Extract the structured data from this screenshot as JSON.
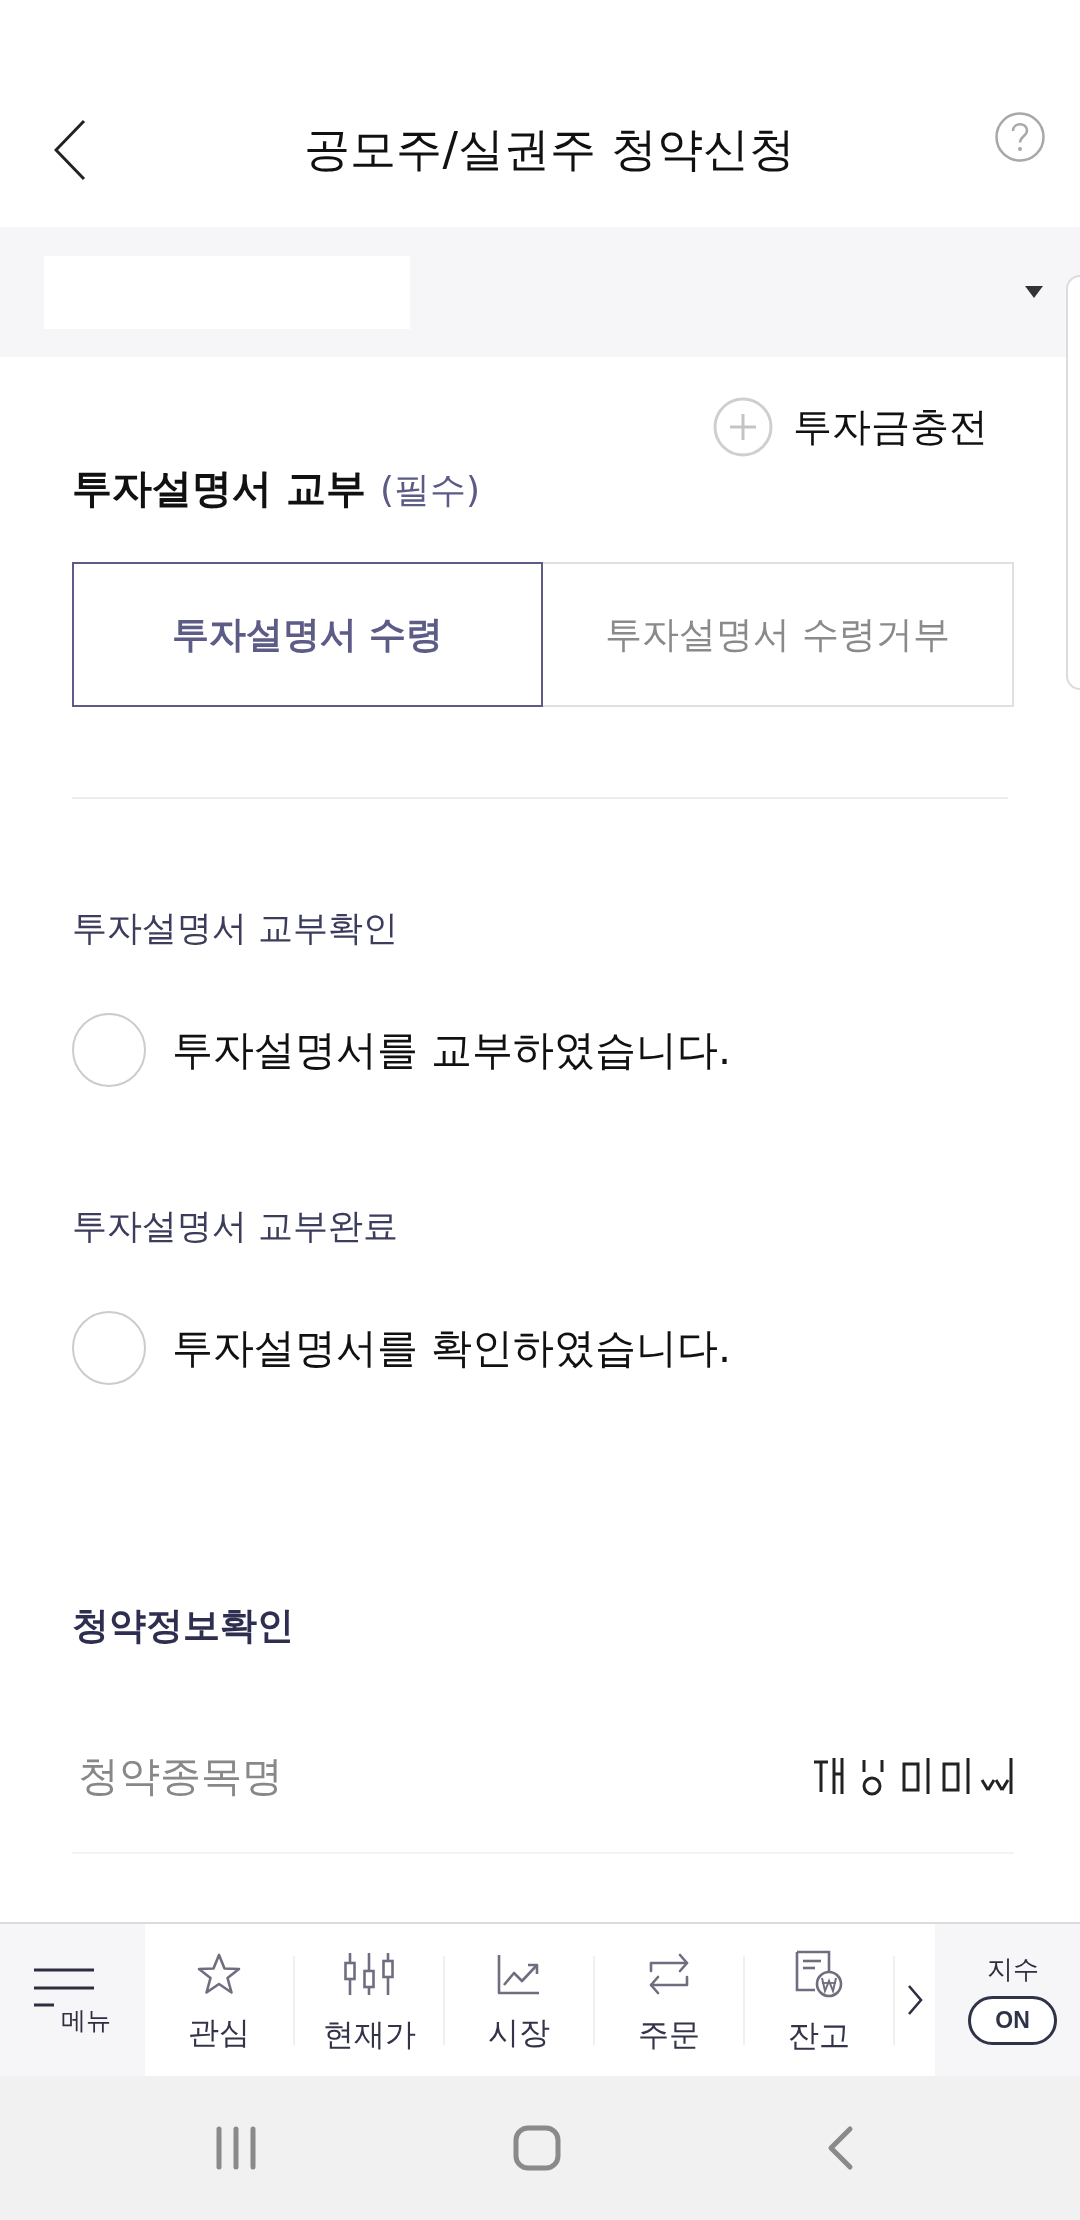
{
  "header": {
    "title": "공모주/실권주 청약신청"
  },
  "charge_button": {
    "label": "투자금충전"
  },
  "prospectus": {
    "title": "투자설명서 교부",
    "required_label": "(필수)",
    "tabs": [
      {
        "label": "투자설명서 수령",
        "selected": true
      },
      {
        "label": "투자설명서 수령거부",
        "selected": false
      }
    ],
    "confirmations": [
      {
        "label": "투자설명서 교부확인",
        "option": "투자설명서를 교부하였습니다.",
        "checked": false
      },
      {
        "label": "투자설명서 교부완료",
        "option": "투자설명서를 확인하였습니다.",
        "checked": false
      }
    ]
  },
  "subscription_info": {
    "title": "청약정보확인",
    "rows": [
      {
        "label": "청약종목명"
      }
    ]
  },
  "bottom_nav": {
    "menu_label": "메뉴",
    "items": [
      {
        "kind": "watch",
        "label": "관심"
      },
      {
        "kind": "quote",
        "label": "현재가"
      },
      {
        "kind": "market",
        "label": "시장"
      },
      {
        "kind": "order",
        "label": "주문"
      },
      {
        "kind": "balance",
        "label": "잔고"
      }
    ],
    "index_label": "지수",
    "index_toggle": "ON"
  }
}
